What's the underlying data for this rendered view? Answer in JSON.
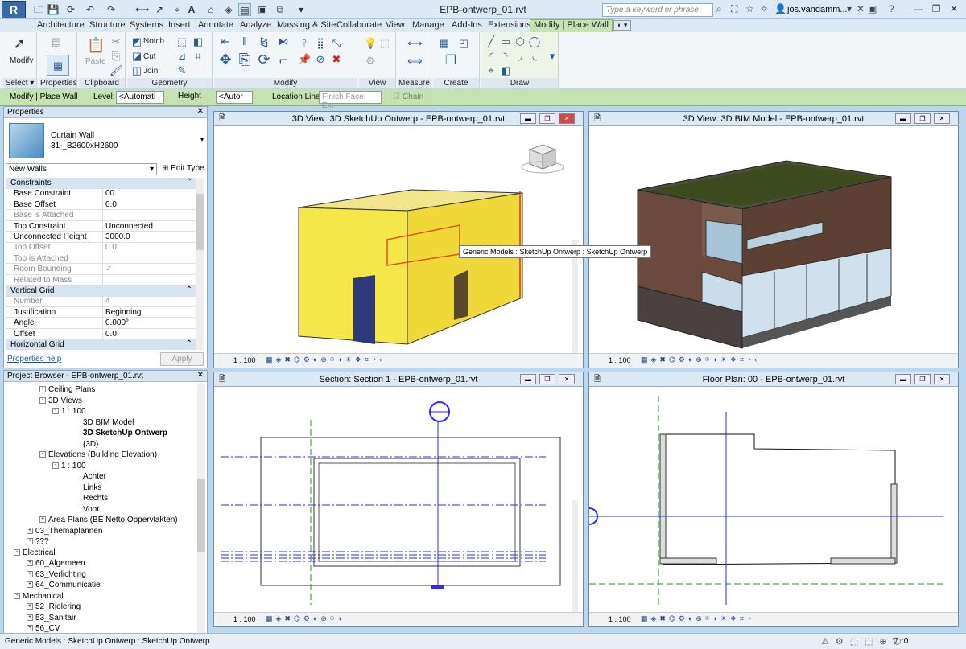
{
  "window": {
    "title": "EPB-ontwerp_01.rvt",
    "app_logo": "R"
  },
  "search": {
    "placeholder": "Type a keyword or phrase"
  },
  "user": {
    "name": "jos.vandamm..."
  },
  "ribbon_tabs": [
    "Architecture",
    "Structure",
    "Systems",
    "Insert",
    "Annotate",
    "Analyze",
    "Massing & Site",
    "Collaborate",
    "View",
    "Manage",
    "Add-Ins",
    "Extensions",
    "Modify | Place Wall"
  ],
  "ribbon_groups": {
    "select": "Select ▾",
    "properties": "Properties",
    "clipboard": "Clipboard",
    "geometry": "Geometry",
    "modify": "Modify",
    "view": "View",
    "measure": "Measure",
    "create": "Create",
    "draw": "Draw"
  },
  "ribbon_buttons": {
    "modify": "Modify",
    "paste": "Paste",
    "notch": "Notch",
    "cut": "Cut",
    "join": "Join"
  },
  "options_bar": {
    "context": "Modify | Place Wall",
    "level_label": "Level:",
    "level_value": "<Automati",
    "height_label": "Height",
    "height_value": "<Autor",
    "location_label": "Location Line:",
    "location_value": "Finish Face: Ext",
    "chain_label": "Chain"
  },
  "properties": {
    "title": "Properties",
    "type_name": "Curtain Wall",
    "type_sub": "31-_B2600xH2600",
    "filter": "New Walls",
    "edit_type": "Edit Type",
    "rows": [
      {
        "k": "Constraints",
        "v": "",
        "sec": true
      },
      {
        "k": "Base Constraint",
        "v": "00"
      },
      {
        "k": "Base Offset",
        "v": "0.0"
      },
      {
        "k": "Base is Attached",
        "v": "",
        "grey": true
      },
      {
        "k": "Top Constraint",
        "v": "Unconnected"
      },
      {
        "k": "Unconnected Height",
        "v": "3000.0"
      },
      {
        "k": "Top Offset",
        "v": "0.0",
        "grey": true
      },
      {
        "k": "Top is Attached",
        "v": "",
        "grey": true
      },
      {
        "k": "Room Bounding",
        "v": "✓",
        "grey": true
      },
      {
        "k": "Related to Mass",
        "v": "",
        "grey": true
      },
      {
        "k": "Vertical Grid",
        "v": "",
        "sec": true
      },
      {
        "k": "Number",
        "v": "4",
        "grey": true
      },
      {
        "k": "Justification",
        "v": "Beginning"
      },
      {
        "k": "Angle",
        "v": "0.000°"
      },
      {
        "k": "Offset",
        "v": "0.0"
      },
      {
        "k": "Horizontal Grid",
        "v": "",
        "sec": true
      }
    ],
    "help": "Properties help",
    "apply": "Apply"
  },
  "browser": {
    "title": "Project Browser - EPB-ontwerp_01.rvt",
    "items": [
      {
        "t": "Ceiling Plans",
        "x": 56,
        "pm": "+"
      },
      {
        "t": "3D Views",
        "x": 56,
        "pm": "-"
      },
      {
        "t": "1 : 100",
        "x": 72,
        "pm": "-"
      },
      {
        "t": "3D BIM Model",
        "x": 98,
        "pm": ""
      },
      {
        "t": "3D SketchUp Ontwerp",
        "x": 98,
        "pm": "",
        "bold": true
      },
      {
        "t": "{3D}",
        "x": 98,
        "pm": ""
      },
      {
        "t": "Elevations (Building Elevation)",
        "x": 56,
        "pm": "-"
      },
      {
        "t": "1 : 100",
        "x": 72,
        "pm": "-"
      },
      {
        "t": "Achter",
        "x": 98,
        "pm": ""
      },
      {
        "t": "Links",
        "x": 98,
        "pm": ""
      },
      {
        "t": "Rechts",
        "x": 98,
        "pm": ""
      },
      {
        "t": "Voor",
        "x": 98,
        "pm": ""
      },
      {
        "t": "Area Plans (BE Netto Oppervlakten)",
        "x": 56,
        "pm": "+"
      },
      {
        "t": "03_Themaplannen",
        "x": 40,
        "pm": "+"
      },
      {
        "t": "???",
        "x": 40,
        "pm": "+"
      },
      {
        "t": "Electrical",
        "x": 24,
        "pm": "-"
      },
      {
        "t": "60_Algemeen",
        "x": 40,
        "pm": "+"
      },
      {
        "t": "63_Verlichting",
        "x": 40,
        "pm": "+"
      },
      {
        "t": "64_Communicatie",
        "x": 40,
        "pm": "+"
      },
      {
        "t": "Mechanical",
        "x": 24,
        "pm": "-"
      },
      {
        "t": "52_Riolering",
        "x": 40,
        "pm": "+"
      },
      {
        "t": "53_Sanitair",
        "x": 40,
        "pm": "+"
      },
      {
        "t": "56_CV",
        "x": 40,
        "pm": "+"
      }
    ]
  },
  "views": {
    "v1": {
      "title": "3D View: 3D SketchUp Ontwerp - EPB-ontwerp_01.rvt",
      "scale": "1 : 100"
    },
    "v2": {
      "title": "3D View: 3D BIM Model - EPB-ontwerp_01.rvt",
      "scale": "1 : 100"
    },
    "v3": {
      "title": "Section: Section 1 - EPB-ontwerp_01.rvt",
      "scale": "1 : 100"
    },
    "v4": {
      "title": "Floor Plan: 00 - EPB-ontwerp_01.rvt",
      "scale": "1 : 100"
    }
  },
  "tooltip": "Generic Models : SketchUp Ontwerp : SketchUp Ontwerp",
  "statusbar": {
    "text": "Generic Models : SketchUp Ontwerp : SketchUp Ontwerp",
    "zero": ":0"
  },
  "colors": {
    "ribbon_context": "#c6e2b3",
    "model_yellow": "#f7e84a",
    "model_brown": "#6b4a3e",
    "roof_green": "#3d4a1e",
    "plan_blue": "#2a2aff",
    "plan_green": "#1a9a1a"
  }
}
